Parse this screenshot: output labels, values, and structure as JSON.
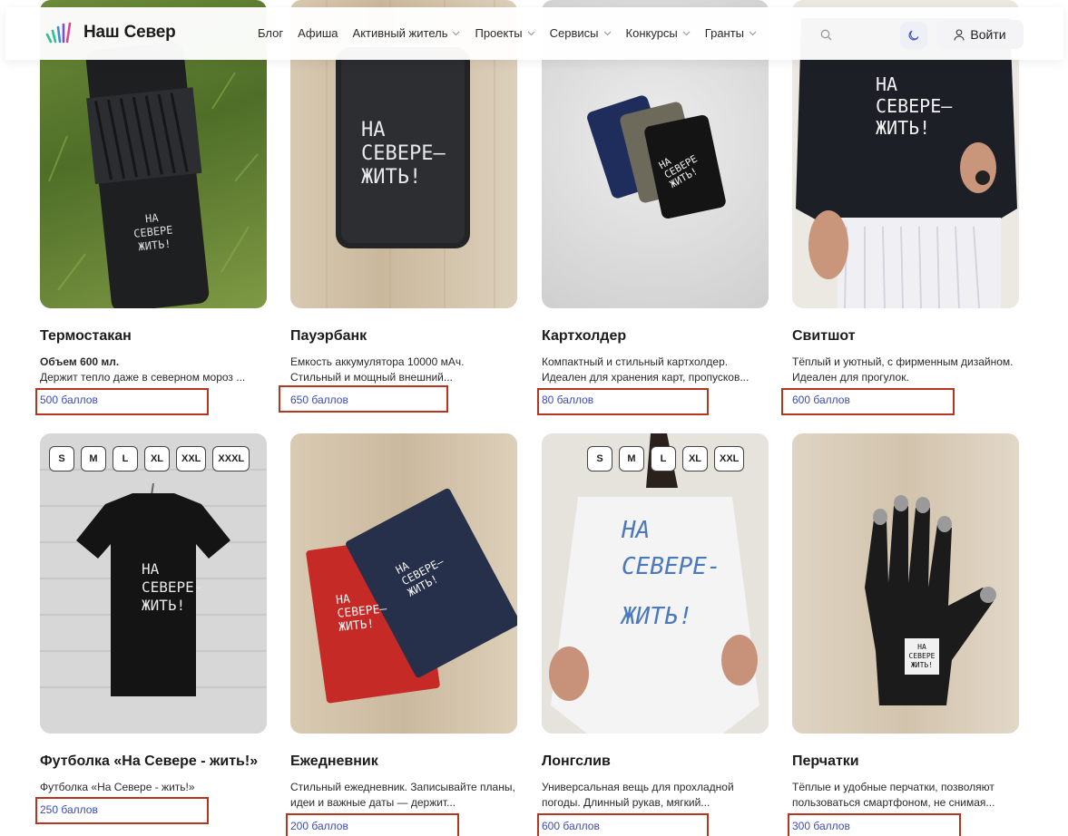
{
  "header": {
    "brand": "Наш Север",
    "nav": [
      {
        "label": "Блог",
        "has_menu": false
      },
      {
        "label": "Афиша",
        "has_menu": false
      },
      {
        "label": "Активный житель",
        "has_menu": true
      },
      {
        "label": "Проекты",
        "has_menu": true
      },
      {
        "label": "Сервисы",
        "has_menu": true
      },
      {
        "label": "Конкурсы",
        "has_menu": true
      },
      {
        "label": "Гранты",
        "has_menu": true
      }
    ],
    "login_label": "Войти",
    "icons": {
      "search": "search-icon",
      "theme": "moon-icon",
      "user": "user-icon",
      "chevron": "chevron-down-icon"
    }
  },
  "colors": {
    "price": "#3b4bb6",
    "highlight": "#b5361f",
    "brand_mark": [
      "#2fbf8e",
      "#3a8fd6",
      "#7b4fd0",
      "#e0468a"
    ]
  },
  "products": [
    {
      "title": "Термостакан",
      "desc_bold": "Объем 600 мл.",
      "desc": "Держит тепло даже в северном мороз ...",
      "price": "500 баллов",
      "image_text": "НА СЕВЕРЕ — ЖИТЬ!"
    },
    {
      "title": "Пауэрбанк",
      "desc_bold": "",
      "desc": "Емкость аккумулятора 10000 мАч. Стильный и мощный внешний...",
      "price": "650 баллов",
      "image_text": "НА СЕВЕРЕ — ЖИТЬ!"
    },
    {
      "title": "Картхолдер",
      "desc_bold": "",
      "desc": "Компактный и стильный картхолдер. Идеален для хранения карт, пропусков...",
      "price": "80 баллов",
      "image_text": "НА СЕВЕРЕ — ЖИТЬ!"
    },
    {
      "title": "Свитшот",
      "desc_bold": "",
      "desc": "Тёплый и уютный, с фирменным дизайном. Идеален для прогулок.",
      "price": "600 баллов",
      "image_text": "НА СЕВЕРЕ— ЖИТЬ!"
    },
    {
      "title": "Футболка «На Севере - жить!»",
      "desc_bold": "",
      "desc": "Футболка «На Севере - жить!»",
      "price": "250 баллов",
      "sizes": [
        "S",
        "M",
        "L",
        "XL",
        "XXL",
        "XXXL"
      ],
      "image_text": "НА СЕВЕРЕ- ЖИТЬ!"
    },
    {
      "title": "Ежедневник",
      "desc_bold": "",
      "desc": "Стильный ежедневник. Записывайте планы, идеи и важные даты — держит...",
      "price": "200 баллов",
      "image_text": "НА СЕВЕРЕ— ЖИТЬ!"
    },
    {
      "title": "Лонгслив",
      "desc_bold": "",
      "desc": "Универсальная вещь для прохладной погоды. Длинный рукав, мягкий...",
      "price": "600 баллов",
      "sizes": [
        "S",
        "M",
        "L",
        "XL",
        "XXL"
      ],
      "image_text": "НА СЕВЕРЕ- ЖИТЬ!"
    },
    {
      "title": "Перчатки",
      "desc_bold": "",
      "desc": "Тёплые и удобные перчатки, позволяют пользоваться смартфоном, не снимая...",
      "price": "300 баллов",
      "image_text": "НА СЕВЕРЕ— ЖИТЬ!"
    }
  ]
}
